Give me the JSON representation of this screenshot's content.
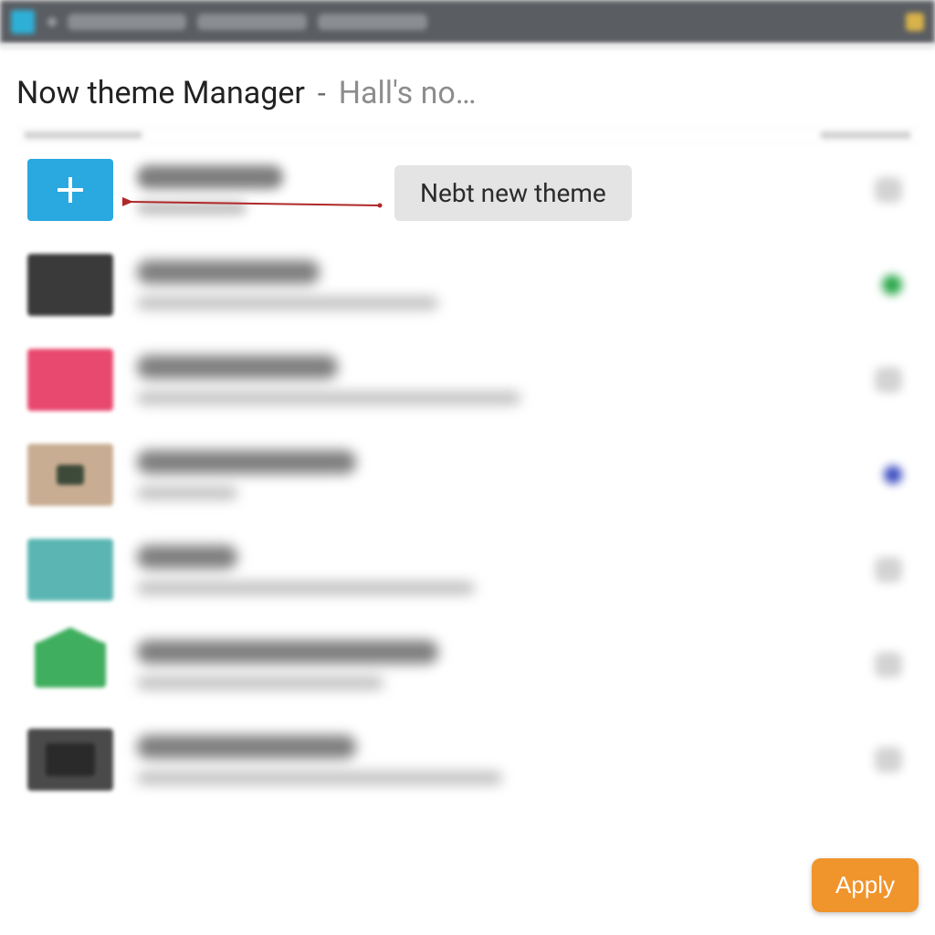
{
  "header": {
    "title": "Now theme Manager",
    "separator": "-",
    "subtitle": "Hall's no…"
  },
  "callout": {
    "label": "Nebt new theme"
  },
  "actions": {
    "apply_label": "Apply"
  },
  "list": {
    "items": [
      {
        "thumb_color": "#2aa8e0",
        "is_add": true
      },
      {
        "thumb_color": "#3a3a3a"
      },
      {
        "thumb_color": "#e84a6f"
      },
      {
        "thumb_color": "#c8ad92"
      },
      {
        "thumb_color": "#5bb6b3"
      },
      {
        "thumb_color": "#3fae5e"
      },
      {
        "thumb_color": "#4a4a4a"
      }
    ]
  }
}
